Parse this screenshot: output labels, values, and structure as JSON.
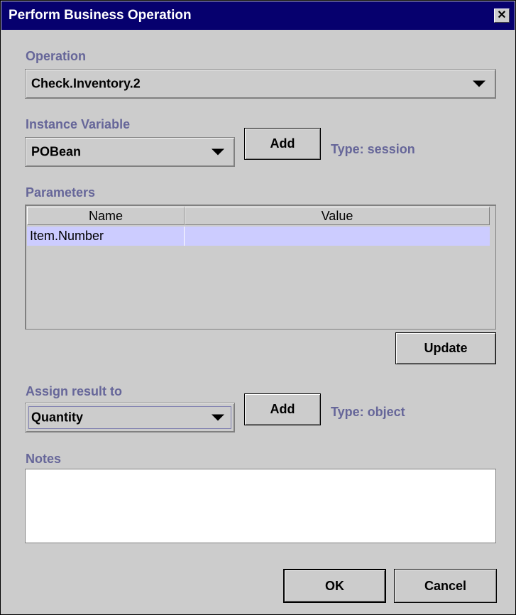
{
  "dialog": {
    "title": "Perform Business Operation",
    "close_glyph": "✕"
  },
  "operation": {
    "label": "Operation",
    "selected": "Check.Inventory.2"
  },
  "instance_variable": {
    "label": "Instance Variable",
    "selected": "POBean",
    "add_label": "Add",
    "type_text": "Type: session"
  },
  "parameters": {
    "label": "Parameters",
    "columns": [
      "Name",
      "Value"
    ],
    "rows": [
      {
        "name": "Item.Number",
        "value": ""
      }
    ],
    "update_label": "Update"
  },
  "assign_result": {
    "label": "Assign result to",
    "selected": "Quantity",
    "add_label": "Add",
    "type_text": "Type: object"
  },
  "notes": {
    "label": "Notes",
    "value": ""
  },
  "footer": {
    "ok_label": "OK",
    "cancel_label": "Cancel"
  },
  "colors": {
    "title_bar": "#06006e",
    "label": "#666699",
    "selected_row": "#ccccff",
    "background": "#cccccc"
  }
}
